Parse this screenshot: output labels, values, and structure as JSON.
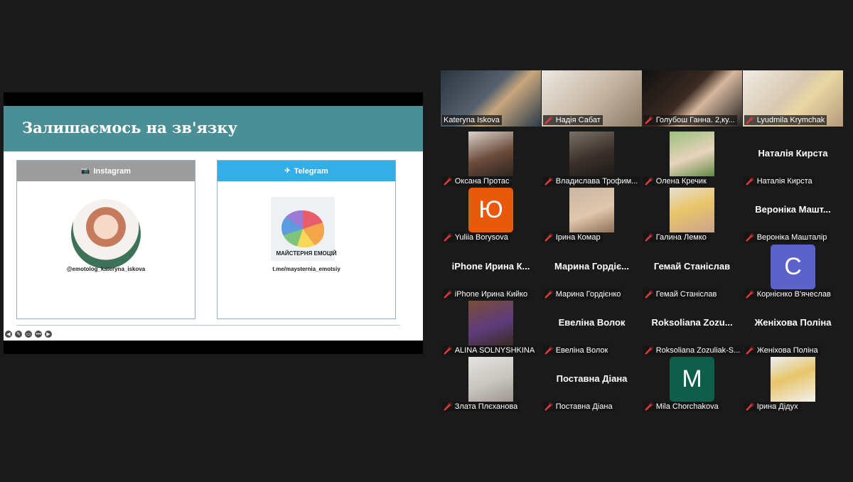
{
  "slide": {
    "title": "Залишаємось на зв'язку",
    "cards": [
      {
        "icon": "camera-icon",
        "icon_glyph": "📷",
        "label": "Instagram",
        "handle": "@emotolog_kateryna_iskova"
      },
      {
        "icon": "send-icon",
        "icon_glyph": "✈",
        "label": "Telegram",
        "name": "МАЙСТЕРНЯ ЕМОЦІЙ",
        "handle": "t.me/maysterniа_emotsiy"
      }
    ],
    "tools": [
      "◀",
      "✎",
      "▭",
      "•••",
      "▶"
    ]
  },
  "participants": [
    {
      "name": "Kateryna Iskova",
      "video": "video",
      "speaking": true,
      "muted": false
    },
    {
      "name": "Надія Сабат",
      "video": "video",
      "muted": true
    },
    {
      "name": "Голубош Ганна. 2,ку...",
      "video": "video",
      "muted": true
    },
    {
      "name": "Lyudmila Krymchak",
      "video": "video",
      "muted": true
    },
    {
      "name": "Оксана Протас",
      "video": "photo",
      "muted": true
    },
    {
      "name": "Владислава Трофим...",
      "video": "photo",
      "muted": true
    },
    {
      "name": "Олена Кречик",
      "video": "photo",
      "muted": true
    },
    {
      "name": "Наталія Кирста",
      "video": "none",
      "display": "Наталія Кирста",
      "muted": true
    },
    {
      "name": "Yuliia Borysova",
      "video": "letter",
      "letter": "Ю",
      "color": "#e8590c",
      "muted": true
    },
    {
      "name": "Ірина Комар",
      "video": "photo",
      "muted": true
    },
    {
      "name": "Галина Лемко",
      "video": "photo",
      "muted": true
    },
    {
      "name": "Вероніка Машталір",
      "video": "none",
      "display": "Вероніка Машт...",
      "muted": true
    },
    {
      "name": "iPhone Ирина Кийко",
      "video": "none",
      "display": "iPhone Ирина К...",
      "muted": true
    },
    {
      "name": "Марина Гордієнко",
      "video": "none",
      "display": "Марина Гордіє...",
      "muted": true
    },
    {
      "name": "Гемай Станіслав",
      "video": "none",
      "display": "Гемай Станіслав",
      "muted": true
    },
    {
      "name": "Корнієнко В'ячеслав",
      "video": "letter",
      "letter": "C",
      "color": "#5b62c9",
      "muted": true
    },
    {
      "name": "ALINA SOLNYSHKINA",
      "video": "photo",
      "muted": true
    },
    {
      "name": "Евеліна Волок",
      "video": "none",
      "display": "Евеліна Волок",
      "muted": true
    },
    {
      "name": "Roksoliana Zozuliak-S...",
      "video": "none",
      "display": "Roksoliana Zozu...",
      "muted": true
    },
    {
      "name": "Женіхова Поліна",
      "video": "none",
      "display": "Женіхова Поліна",
      "muted": true
    },
    {
      "name": "Злата Плєханова",
      "video": "photo",
      "muted": true
    },
    {
      "name": "Поставна Діана",
      "video": "none",
      "display": "Поставна Діана",
      "muted": true
    },
    {
      "name": "Mila Chorchakova",
      "video": "letter",
      "letter": "M",
      "color": "#0f5e49",
      "muted": true
    },
    {
      "name": "Ірина Дідух",
      "video": "photo",
      "muted": true
    }
  ]
}
